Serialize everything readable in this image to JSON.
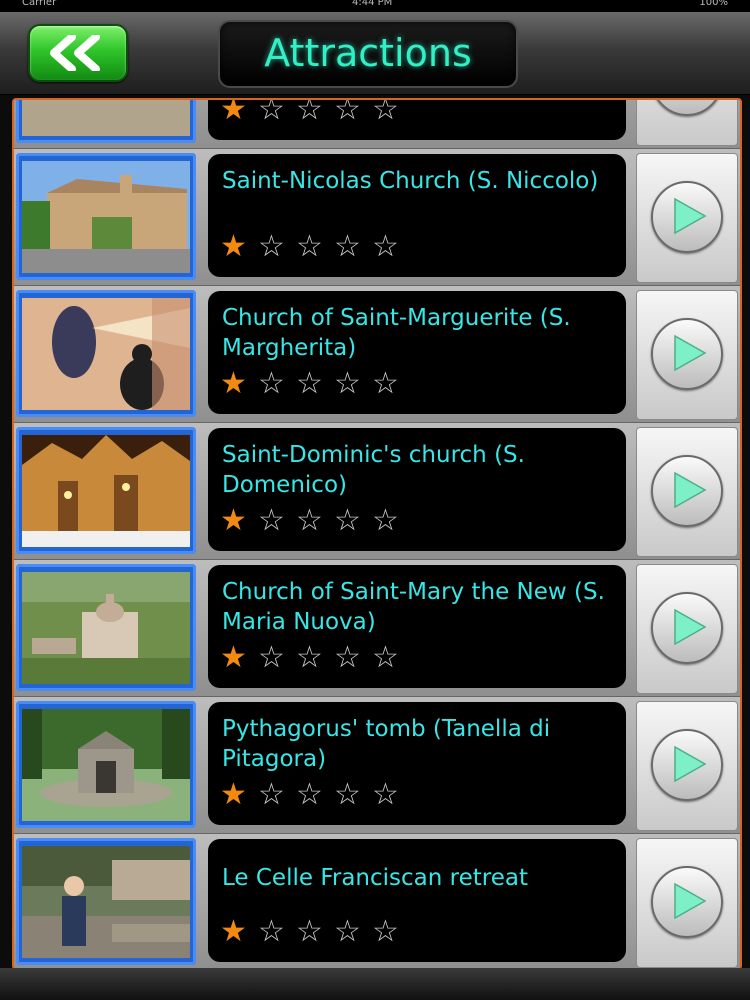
{
  "status_bar": {
    "carrier": "Carrier",
    "time": "4:44 PM",
    "battery": "100%"
  },
  "header": {
    "title": "Attractions",
    "back_icon": "double-chevron-left-icon"
  },
  "colors": {
    "title": "#30f0c6",
    "name": "#38e6e6",
    "star_on": "#f28a12",
    "star_off": "#c8c8c8",
    "frame": "#d8641f",
    "back": "#2fc52a",
    "go_arrow": "#7ef0c8"
  },
  "rating_scale": 5,
  "attractions": [
    {
      "name": "",
      "rating": 1
    },
    {
      "name": "Saint-Nicolas Church (S. Niccolo)",
      "rating": 1
    },
    {
      "name": "Church of Saint-Marguerite (S. Margherita)",
      "rating": 1
    },
    {
      "name": "Saint-Dominic's church (S. Domenico)",
      "rating": 1
    },
    {
      "name": "Church of Saint-Mary the New (S. Maria Nuova)",
      "rating": 1
    },
    {
      "name": "Pythagorus' tomb (Tanella di Pitagora)",
      "rating": 1
    },
    {
      "name": "Le Celle Franciscan retreat",
      "rating": 1
    }
  ]
}
